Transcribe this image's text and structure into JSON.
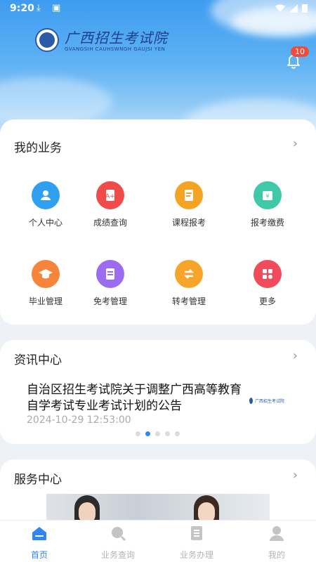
{
  "status": {
    "time": "9:20"
  },
  "brand": {
    "name_cn": "广西招生考试院",
    "name_en": "GVANGSIH CAUHSWNGH GAUJSI YEN"
  },
  "notifications": {
    "count": "10"
  },
  "business": {
    "title": "我的业务",
    "items": [
      {
        "label": "个人中心",
        "icon": "user-icon",
        "color": "#2fa0f0"
      },
      {
        "label": "成绩查询",
        "icon": "grade-icon",
        "color": "#f04a4a"
      },
      {
        "label": "课程报考",
        "icon": "course-icon",
        "color": "#f5a323"
      },
      {
        "label": "报考缴费",
        "icon": "payment-icon",
        "color": "#3fc9a8"
      },
      {
        "label": "毕业管理",
        "icon": "graduation-icon",
        "color": "#f6843a"
      },
      {
        "label": "免考管理",
        "icon": "exempt-icon",
        "color": "#9b6cf0"
      },
      {
        "label": "转考管理",
        "icon": "transfer-icon",
        "color": "#f7a52a"
      },
      {
        "label": "更多",
        "icon": "more-icon",
        "color": "#f04b5a"
      }
    ]
  },
  "news": {
    "title": "资讯中心",
    "headline": "自治区招生考试院关于调整广西高等教育自学考试专业考试计划的公告",
    "date": "2024-10-29 12:53:00",
    "thumb_text": "广西招生考试院",
    "pages": 5,
    "active_page": 2
  },
  "service": {
    "title": "服务中心"
  },
  "tabs": [
    {
      "label": "首页",
      "icon": "home-icon",
      "active": true
    },
    {
      "label": "业务查询",
      "icon": "search-icon",
      "active": false
    },
    {
      "label": "业务办理",
      "icon": "document-icon",
      "active": false
    },
    {
      "label": "我的",
      "icon": "profile-icon",
      "active": false
    }
  ],
  "colors": {
    "accent": "#2f86ef",
    "badge": "#f24a3d"
  }
}
